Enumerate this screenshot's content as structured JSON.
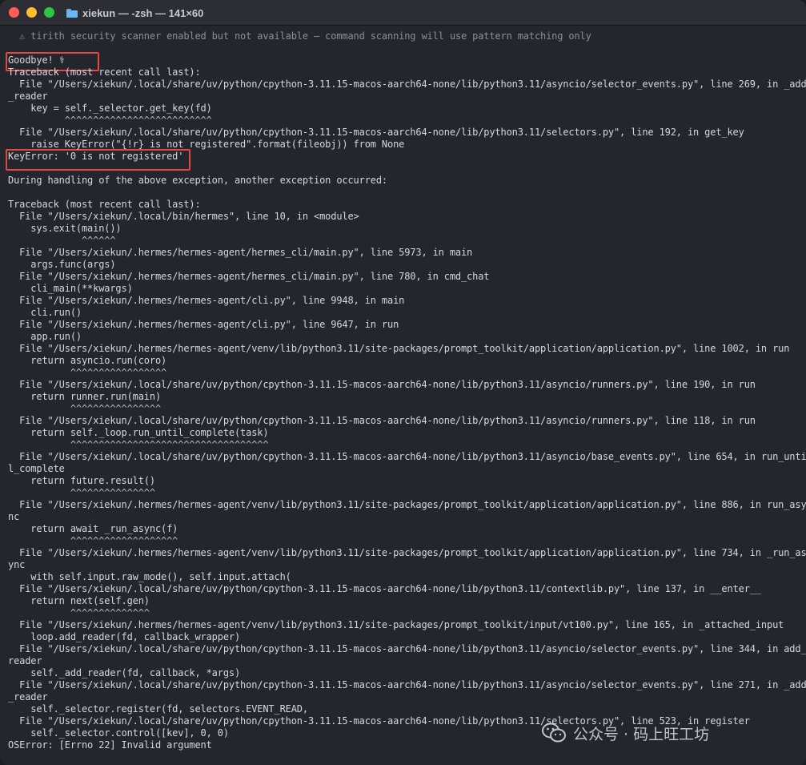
{
  "window": {
    "title": "xiekun — -zsh — 141×60"
  },
  "terminal": {
    "lines": [
      "  ⚠ tirith security scanner enabled but not available — command scanning will use pattern matching only",
      "",
      "Goodbye! ⚕",
      "Traceback (most recent call last):",
      "  File \"/Users/xiekun/.local/share/uv/python/cpython-3.11.15-macos-aarch64-none/lib/python3.11/asyncio/selector_events.py\", line 269, in _add",
      "_reader",
      "    key = self._selector.get_key(fd)",
      "          ^^^^^^^^^^^^^^^^^^^^^^^^^^",
      "  File \"/Users/xiekun/.local/share/uv/python/cpython-3.11.15-macos-aarch64-none/lib/python3.11/selectors.py\", line 192, in get_key",
      "    raise KeyError(\"{!r} is not registered\".format(fileobj)) from None",
      "KeyError: '0 is not registered'",
      "",
      "During handling of the above exception, another exception occurred:",
      "",
      "Traceback (most recent call last):",
      "  File \"/Users/xiekun/.local/bin/hermes\", line 10, in <module>",
      "    sys.exit(main())",
      "             ^^^^^^",
      "  File \"/Users/xiekun/.hermes/hermes-agent/hermes_cli/main.py\", line 5973, in main",
      "    args.func(args)",
      "  File \"/Users/xiekun/.hermes/hermes-agent/hermes_cli/main.py\", line 780, in cmd_chat",
      "    cli_main(**kwargs)",
      "  File \"/Users/xiekun/.hermes/hermes-agent/cli.py\", line 9948, in main",
      "    cli.run()",
      "  File \"/Users/xiekun/.hermes/hermes-agent/cli.py\", line 9647, in run",
      "    app.run()",
      "  File \"/Users/xiekun/.hermes/hermes-agent/venv/lib/python3.11/site-packages/prompt_toolkit/application/application.py\", line 1002, in run",
      "    return asyncio.run(coro)",
      "           ^^^^^^^^^^^^^^^^^",
      "  File \"/Users/xiekun/.local/share/uv/python/cpython-3.11.15-macos-aarch64-none/lib/python3.11/asyncio/runners.py\", line 190, in run",
      "    return runner.run(main)",
      "           ^^^^^^^^^^^^^^^^",
      "  File \"/Users/xiekun/.local/share/uv/python/cpython-3.11.15-macos-aarch64-none/lib/python3.11/asyncio/runners.py\", line 118, in run",
      "    return self._loop.run_until_complete(task)",
      "           ^^^^^^^^^^^^^^^^^^^^^^^^^^^^^^^^^^^",
      "  File \"/Users/xiekun/.local/share/uv/python/cpython-3.11.15-macos-aarch64-none/lib/python3.11/asyncio/base_events.py\", line 654, in run_unti",
      "l_complete",
      "    return future.result()",
      "           ^^^^^^^^^^^^^^^",
      "  File \"/Users/xiekun/.hermes/hermes-agent/venv/lib/python3.11/site-packages/prompt_toolkit/application/application.py\", line 886, in run_asy",
      "nc",
      "    return await _run_async(f)",
      "           ^^^^^^^^^^^^^^^^^^^",
      "  File \"/Users/xiekun/.hermes/hermes-agent/venv/lib/python3.11/site-packages/prompt_toolkit/application/application.py\", line 734, in _run_as",
      "ync",
      "    with self.input.raw_mode(), self.input.attach(",
      "  File \"/Users/xiekun/.local/share/uv/python/cpython-3.11.15-macos-aarch64-none/lib/python3.11/contextlib.py\", line 137, in __enter__",
      "    return next(self.gen)",
      "           ^^^^^^^^^^^^^^",
      "  File \"/Users/xiekun/.hermes/hermes-agent/venv/lib/python3.11/site-packages/prompt_toolkit/input/vt100.py\", line 165, in _attached_input",
      "    loop.add_reader(fd, callback_wrapper)",
      "  File \"/Users/xiekun/.local/share/uv/python/cpython-3.11.15-macos-aarch64-none/lib/python3.11/asyncio/selector_events.py\", line 344, in add_",
      "reader",
      "    self._add_reader(fd, callback, *args)",
      "  File \"/Users/xiekun/.local/share/uv/python/cpython-3.11.15-macos-aarch64-none/lib/python3.11/asyncio/selector_events.py\", line 271, in _add",
      "_reader",
      "    self._selector.register(fd, selectors.EVENT_READ,",
      "  File \"/Users/xiekun/.local/share/uv/python/cpython-3.11.15-macos-aarch64-none/lib/python3.11/selectors.py\", line 523, in register",
      "    self._selector.control([kev], 0, 0)",
      "OSError: [Errno 22] Invalid argument"
    ]
  },
  "watermark": {
    "text": "公众号 · 码上旺工坊",
    "icon": "wechat-icon"
  },
  "colors": {
    "highlight": "#e04a3f",
    "background": "#24262d",
    "text": "#d6d7dc"
  }
}
